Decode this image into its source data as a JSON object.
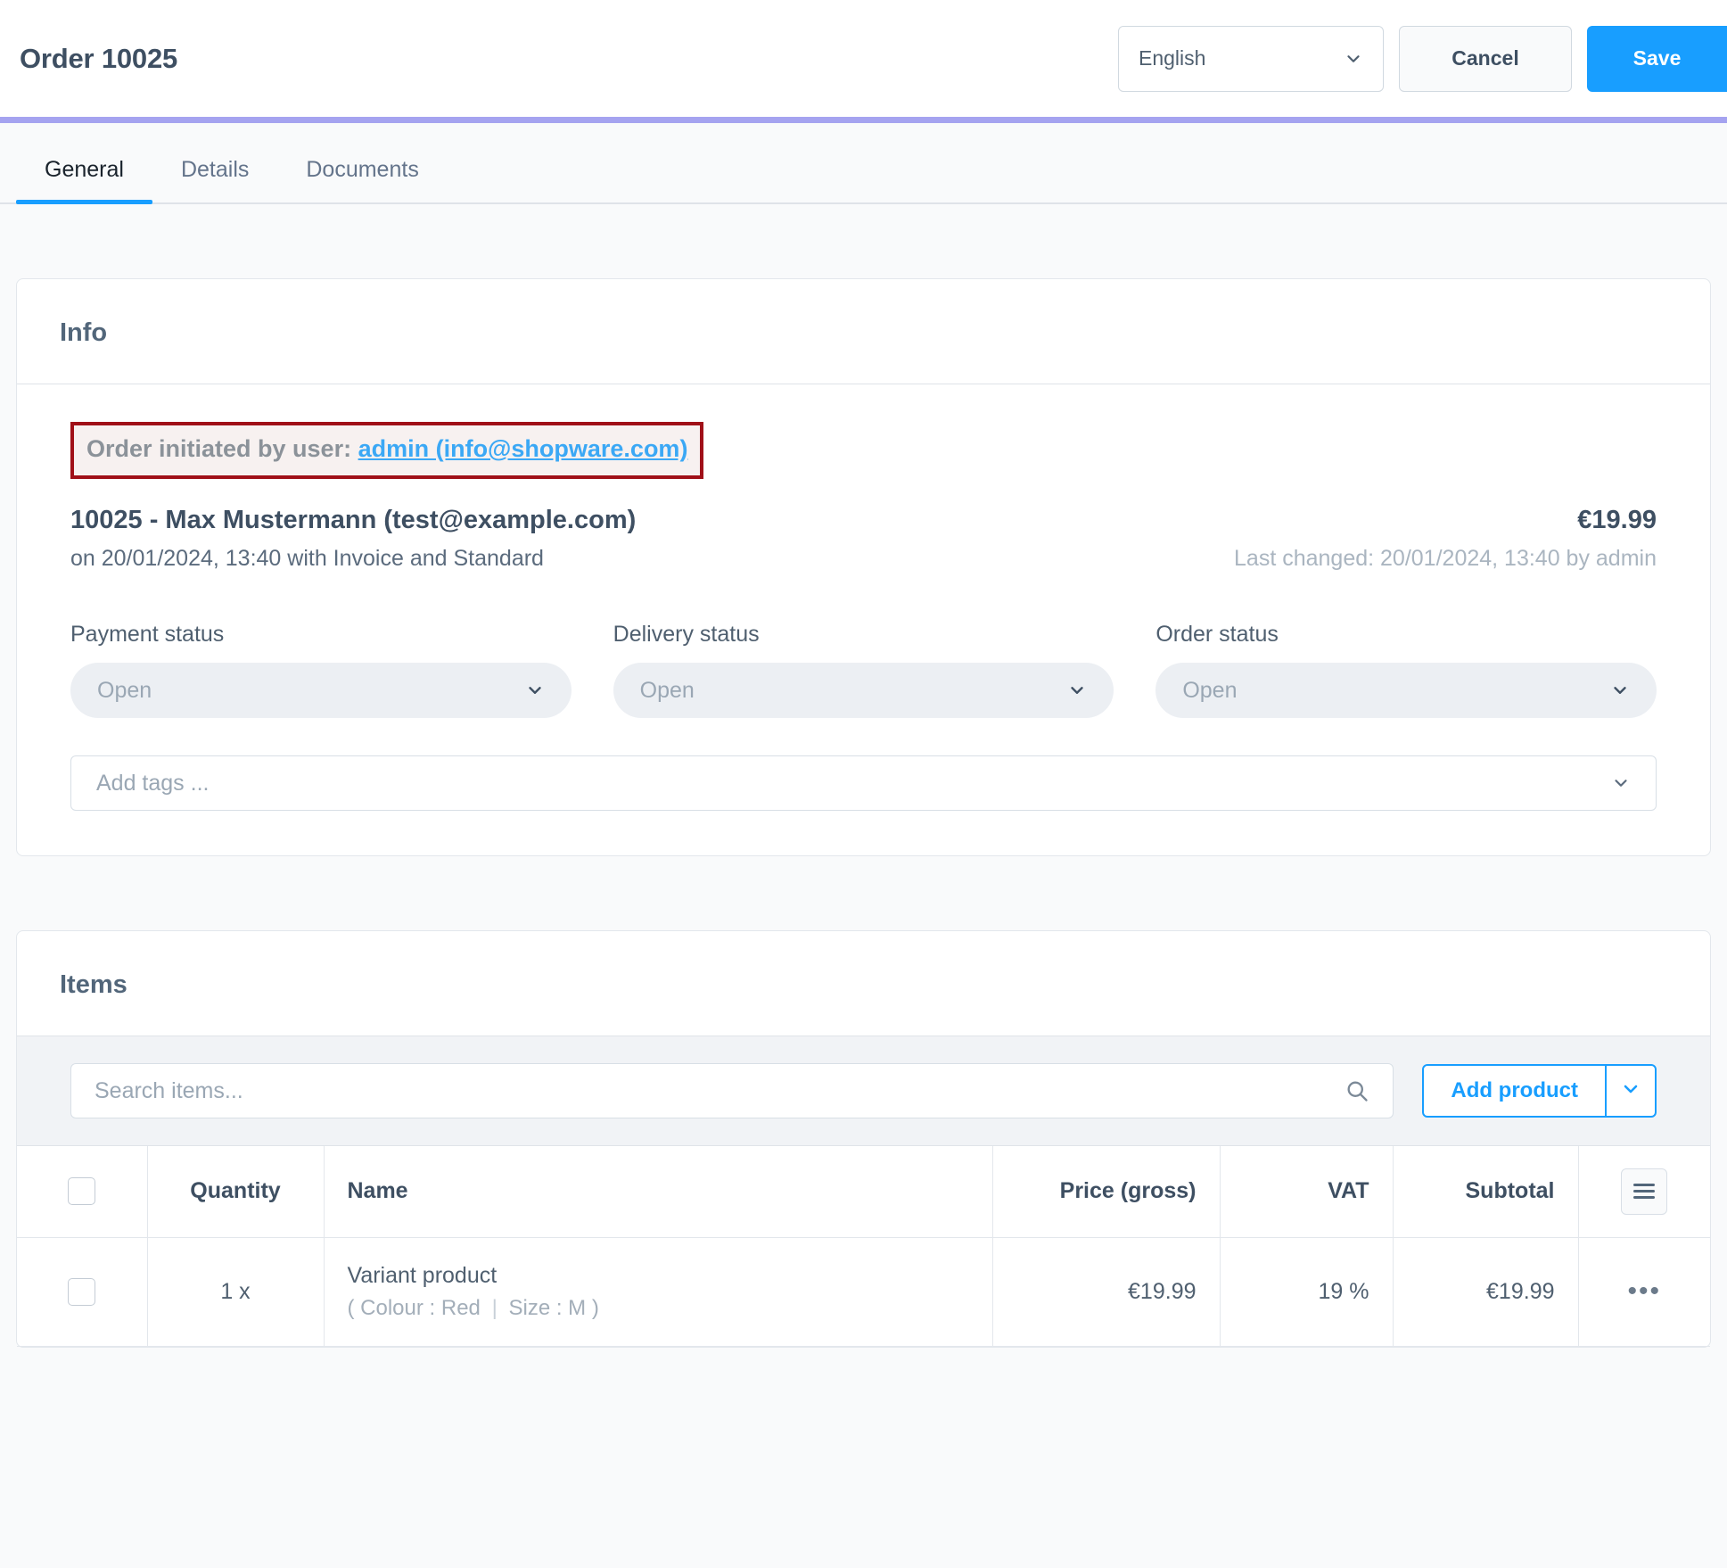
{
  "header": {
    "title": "Order 10025",
    "language_value": "English",
    "cancel_label": "Cancel",
    "save_label": "Save"
  },
  "tabs": [
    {
      "label": "General",
      "active": true
    },
    {
      "label": "Details",
      "active": false
    },
    {
      "label": "Documents",
      "active": false
    }
  ],
  "info_card": {
    "title": "Info",
    "annotation": {
      "prefix": "Order initiated by user: ",
      "link": "admin (info@shopware.com)",
      "border_color": "#a01018",
      "background": "#f7f1f0"
    },
    "summary": {
      "main": "10025 - Max Mustermann (test@example.com)",
      "price": "€19.99",
      "sub": "on 20/01/2024, 13:40 with Invoice and Standard",
      "last_changed": "Last changed: 20/01/2024, 13:40 by admin"
    },
    "statuses": [
      {
        "label": "Payment status",
        "value": "Open"
      },
      {
        "label": "Delivery status",
        "value": "Open"
      },
      {
        "label": "Order status",
        "value": "Open"
      }
    ],
    "tags_placeholder": "Add tags ..."
  },
  "items_card": {
    "title": "Items",
    "search_placeholder": "Search items...",
    "add_product_label": "Add product",
    "columns": [
      "",
      "Quantity",
      "Name",
      "Price (gross)",
      "VAT",
      "Subtotal",
      ""
    ],
    "rows": [
      {
        "quantity": "1 x",
        "name": "Variant product",
        "option_open": "(",
        "option_1": "Colour : Red",
        "option_sep": "|",
        "option_2": "Size : M",
        "option_close": ")",
        "price": "€19.99",
        "vat": "19 %",
        "subtotal": "€19.99",
        "menu": "•••"
      }
    ]
  },
  "colors": {
    "accent": "#189eff",
    "accent_bar": "#a5a3f0",
    "text_dark": "#3e4f62",
    "text_muted": "#9aa7b4",
    "link": "#3ba8f5"
  }
}
